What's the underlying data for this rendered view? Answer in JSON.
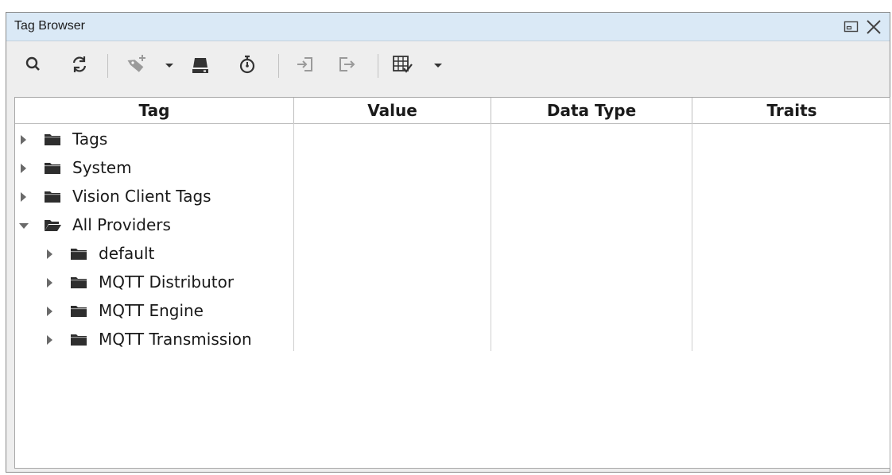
{
  "window": {
    "title": "Tag Browser",
    "buttons": [
      "restore-icon",
      "close-icon"
    ]
  },
  "toolbar": {
    "icons": [
      "search-icon",
      "refresh-icon",
      "add-tag-icon",
      "dropdown-caret-icon",
      "server-icon",
      "timer-icon",
      "import-icon",
      "export-icon",
      "table-columns-icon",
      "dropdown-caret-icon"
    ]
  },
  "columns": [
    {
      "label": "Tag"
    },
    {
      "label": "Value"
    },
    {
      "label": "Data Type"
    },
    {
      "label": "Traits"
    }
  ],
  "tree": [
    {
      "label": "Tags",
      "level": 0,
      "expanded": false
    },
    {
      "label": "System",
      "level": 0,
      "expanded": false
    },
    {
      "label": "Vision Client Tags",
      "level": 0,
      "expanded": false
    },
    {
      "label": "All Providers",
      "level": 0,
      "expanded": true
    },
    {
      "label": "default",
      "level": 1,
      "expanded": false
    },
    {
      "label": "MQTT Distributor",
      "level": 1,
      "expanded": false
    },
    {
      "label": "MQTT Engine",
      "level": 1,
      "expanded": false
    },
    {
      "label": "MQTT Transmission",
      "level": 1,
      "expanded": false
    }
  ],
  "colors": {
    "titlebar": "#dae9f6",
    "folder": "#2e2e2e",
    "icon": "#333333",
    "disabled_icon": "#9a9a9a"
  }
}
